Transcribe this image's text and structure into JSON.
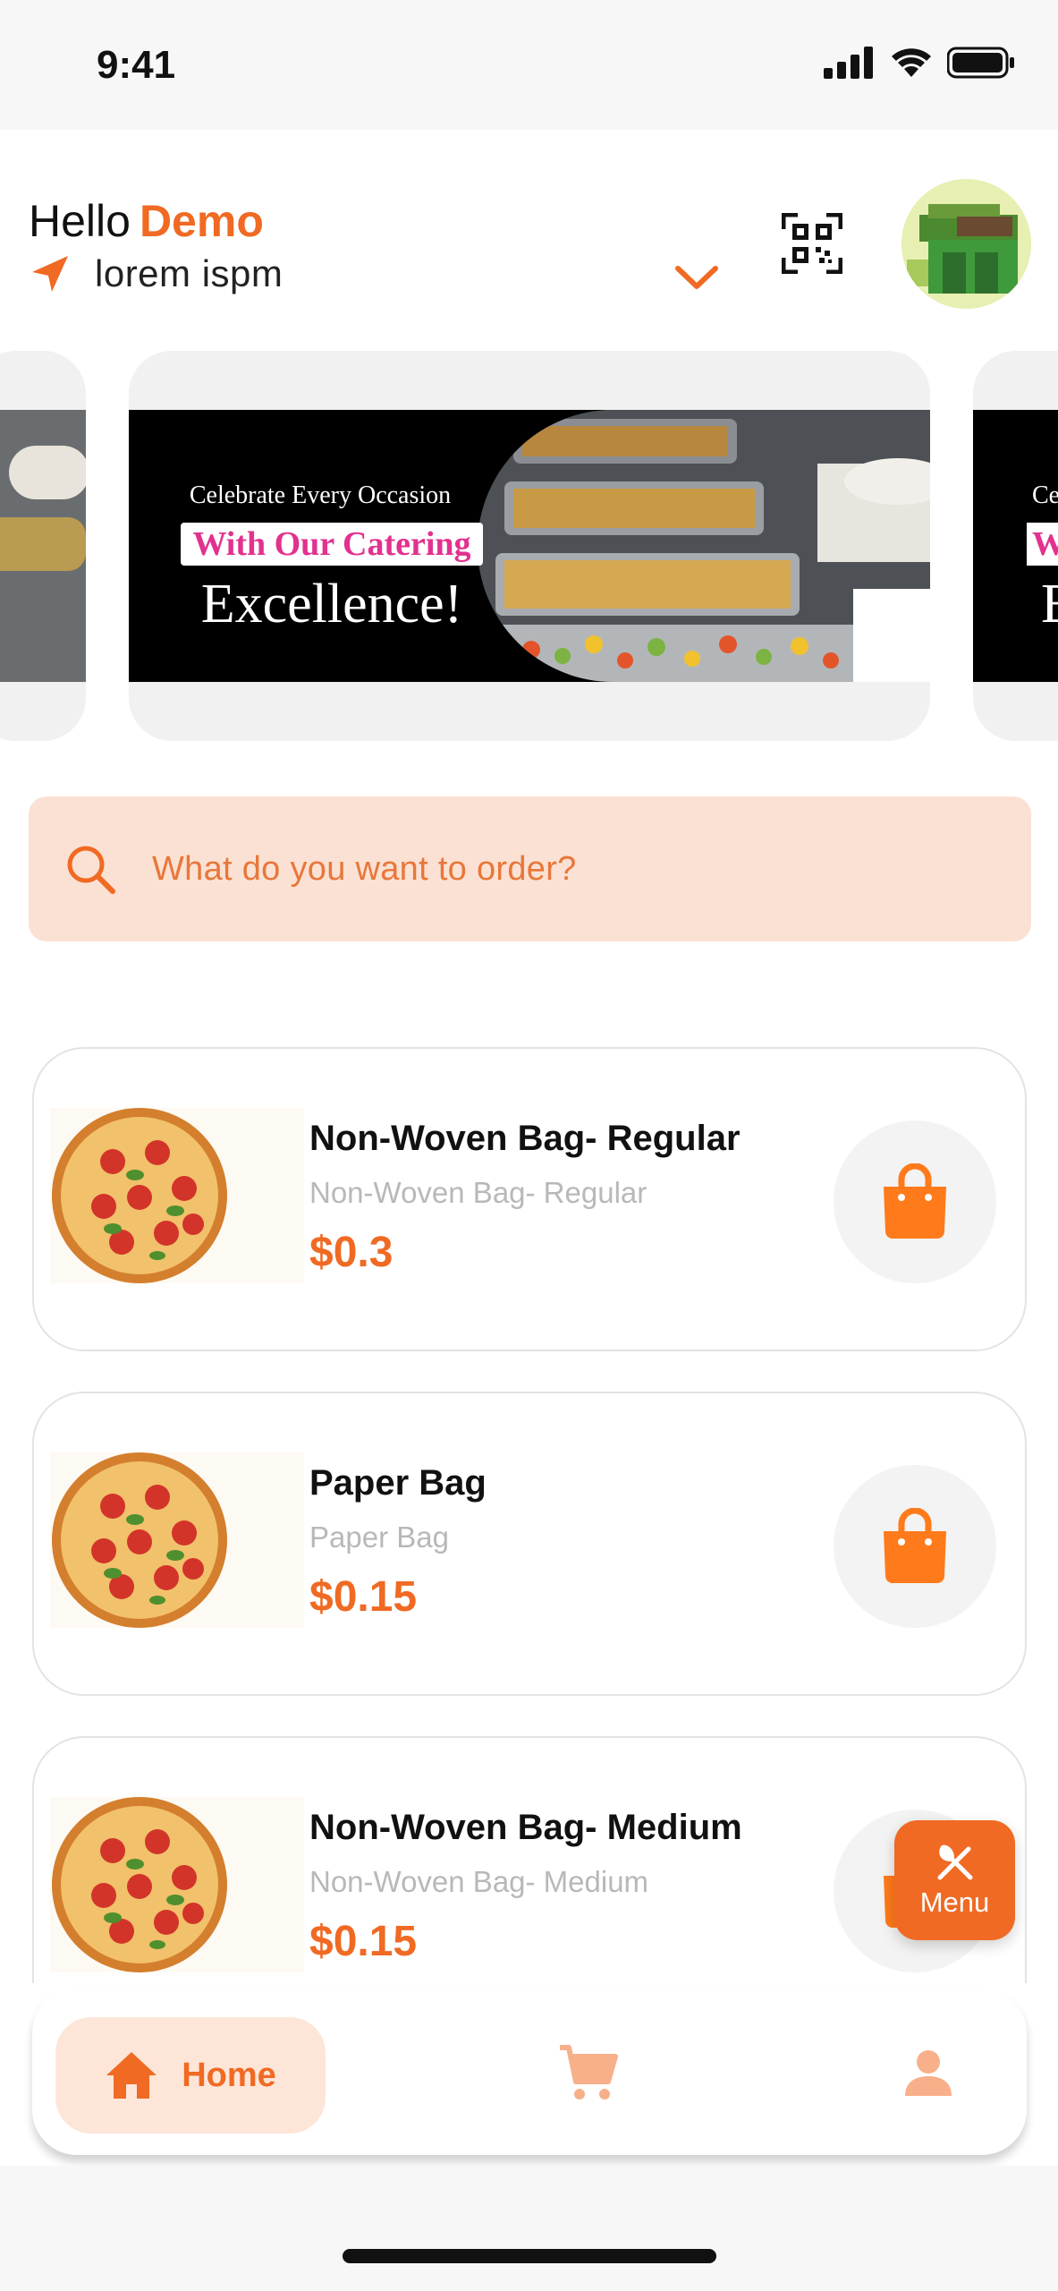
{
  "status_bar": {
    "time": "9:41"
  },
  "header": {
    "greeting": "Hello",
    "user_name": "Demo",
    "location": "lorem ispm"
  },
  "banner": {
    "line1": "Celebrate Every Occasion",
    "line2": "With Our Catering",
    "line3": "Excellence!",
    "peek_left_line1": "",
    "peek_right_line1": "Ce",
    "peek_right_line2": "W",
    "peek_right_line3": "E"
  },
  "search": {
    "placeholder": "What do you want to order?"
  },
  "products": [
    {
      "title": "Non-Woven Bag- Regular",
      "subtitle": "Non-Woven Bag- Regular",
      "price": "$0.3"
    },
    {
      "title": "Paper Bag",
      "subtitle": "Paper Bag",
      "price": "$0.15"
    },
    {
      "title": "Non-Woven Bag- Medium",
      "subtitle": "Non-Woven Bag- Medium",
      "price": "$0.15"
    }
  ],
  "menu_fab": {
    "label": "Menu"
  },
  "bottom_nav": {
    "home_label": "Home",
    "items": [
      "home-icon",
      "cart-icon",
      "profile-icon"
    ]
  },
  "colors": {
    "accent": "#f06a23",
    "search_bg": "#fbe1d3",
    "nav_active_bg": "#fde6d8"
  }
}
